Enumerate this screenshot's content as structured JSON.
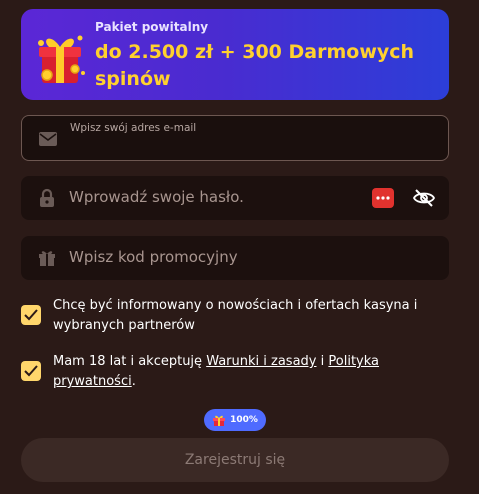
{
  "banner": {
    "subtitle": "Pakiet powitalny",
    "title": "do 2.500 zł + 300 Darmowych spinów"
  },
  "email": {
    "label": "Wpisz swój adres e-mail",
    "value": ""
  },
  "password": {
    "placeholder": "Wprowadź swoje hasło.",
    "value": ""
  },
  "promo": {
    "placeholder": "Wpisz kod promocyjny",
    "value": ""
  },
  "consent_news": {
    "checked": true,
    "text": "Chcę być informowany o nowościach i ofertach kasyna i wybranych partnerów"
  },
  "consent_terms": {
    "checked": true,
    "prefix": "Mam 18 lat i akceptuję ",
    "link1": "Warunki i zasady",
    "middle": " i ",
    "link2": "Polityka prywatności",
    "suffix": "."
  },
  "bonus_badge": {
    "text": "100%"
  },
  "submit": {
    "label": "Zarejestruj się"
  },
  "colors": {
    "background": "#2b1a17",
    "banner_accent": "#ffd12e",
    "checkbox": "#ffd66b",
    "badge": "#4f6bff",
    "password_generator": "#e1322e"
  },
  "icons": [
    "gift-box-icon",
    "envelope-icon",
    "lock-icon",
    "password-generator-icon",
    "eye-slash-icon",
    "gift-icon",
    "checkmark-icon"
  ]
}
